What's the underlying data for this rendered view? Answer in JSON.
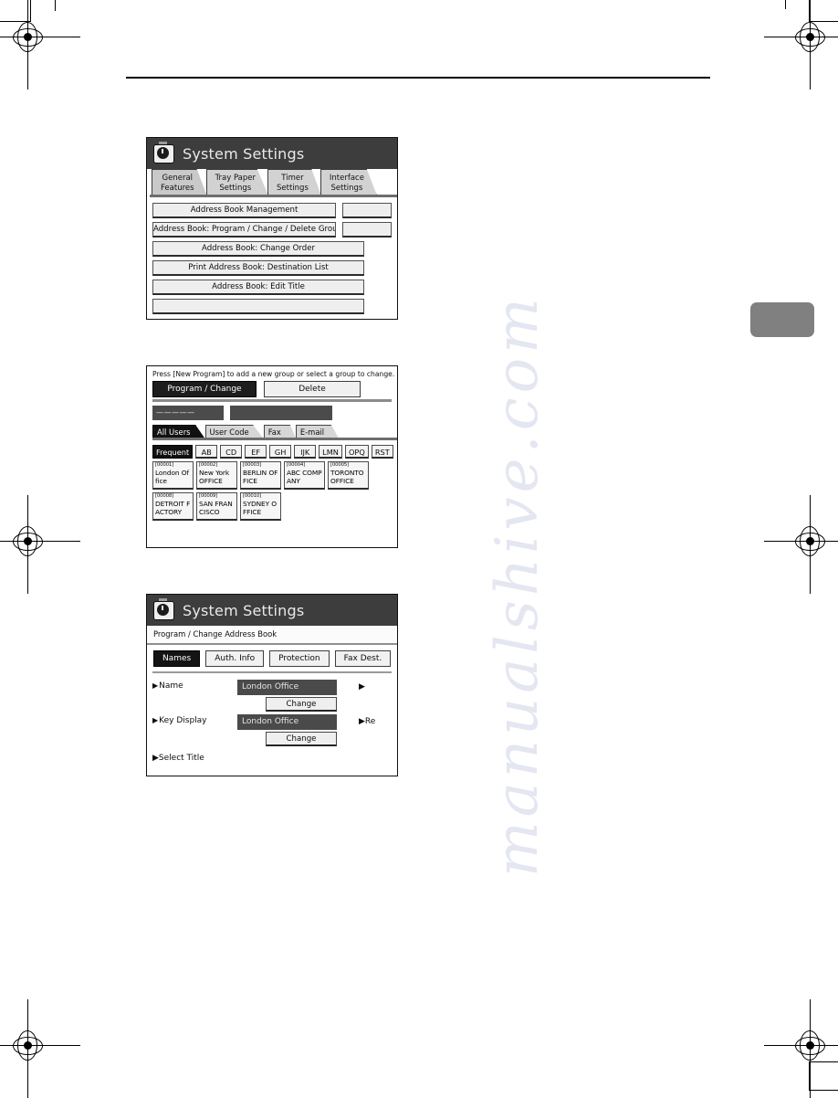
{
  "document": {
    "type": "printed-manual-page",
    "watermark_text": "manualshive.com"
  },
  "panel1": {
    "title": "System Settings",
    "title_icon": "clock-settings-icon",
    "tabs": [
      {
        "label": "General\nFeatures",
        "selected": true
      },
      {
        "label": "Tray Paper\nSettings",
        "selected": false
      },
      {
        "label": "Timer\nSettings",
        "selected": false
      },
      {
        "label": "Interface\nSettings",
        "selected": false
      }
    ],
    "buttons": [
      "Address Book Management",
      "Address Book: Program / Change / Delete Group",
      "Address Book: Change Order",
      "Print Address Book: Destination List",
      "Address Book: Edit Title"
    ]
  },
  "panel2": {
    "hint": "Press [New Program] to add a new group or select a group to change. Groups can b",
    "actions": [
      {
        "label": "Program / Change",
        "selected": true
      },
      {
        "label": "Delete",
        "selected": false
      }
    ],
    "placeholder_dashes": "—————",
    "tabs": [
      {
        "label": "All Users",
        "selected": true
      },
      {
        "label": "User Code",
        "selected": false
      },
      {
        "label": "Fax",
        "selected": false
      },
      {
        "label": "E-mail",
        "selected": false
      }
    ],
    "index_buttons": [
      {
        "label": "Frequent",
        "selected": true
      },
      {
        "label": "AB",
        "selected": false
      },
      {
        "label": "CD",
        "selected": false
      },
      {
        "label": "EF",
        "selected": false
      },
      {
        "label": "GH",
        "selected": false
      },
      {
        "label": "IJK",
        "selected": false
      },
      {
        "label": "LMN",
        "selected": false
      },
      {
        "label": "OPQ",
        "selected": false
      },
      {
        "label": "RST",
        "selected": false
      }
    ],
    "destinations": [
      {
        "code": "[00001]",
        "name": "London Office"
      },
      {
        "code": "[00002]",
        "name": "New York OFFICE"
      },
      {
        "code": "[00003]",
        "name": "BERLIN OFFICE"
      },
      {
        "code": "[00004]",
        "name": "ABC COMPANY"
      },
      {
        "code": "[00005]",
        "name": "TORONTO OFFICE"
      },
      {
        "code": "[00008]",
        "name": "DETROIT FACTORY"
      },
      {
        "code": "[00009]",
        "name": "SAN FRANCISCO"
      },
      {
        "code": "[00010]",
        "name": "SYDNEY OFFICE"
      }
    ]
  },
  "panel3": {
    "title": "System Settings",
    "title_icon": "clock-settings-icon",
    "breadcrumb": "Program / Change Address Book",
    "tabs": [
      {
        "label": "Names",
        "selected": true
      },
      {
        "label": "Auth. Info",
        "selected": false
      },
      {
        "label": "Protection",
        "selected": false
      },
      {
        "label": "Fax Dest.",
        "selected": false
      }
    ],
    "fields": [
      {
        "label": "Name",
        "value": "London Office",
        "change_label": "Change",
        "right_fragment": "▶"
      },
      {
        "label": "Key Display",
        "value": "London Office",
        "change_label": "Change",
        "right_fragment": "▶Re"
      }
    ],
    "tail_label": "▶Select Title"
  }
}
